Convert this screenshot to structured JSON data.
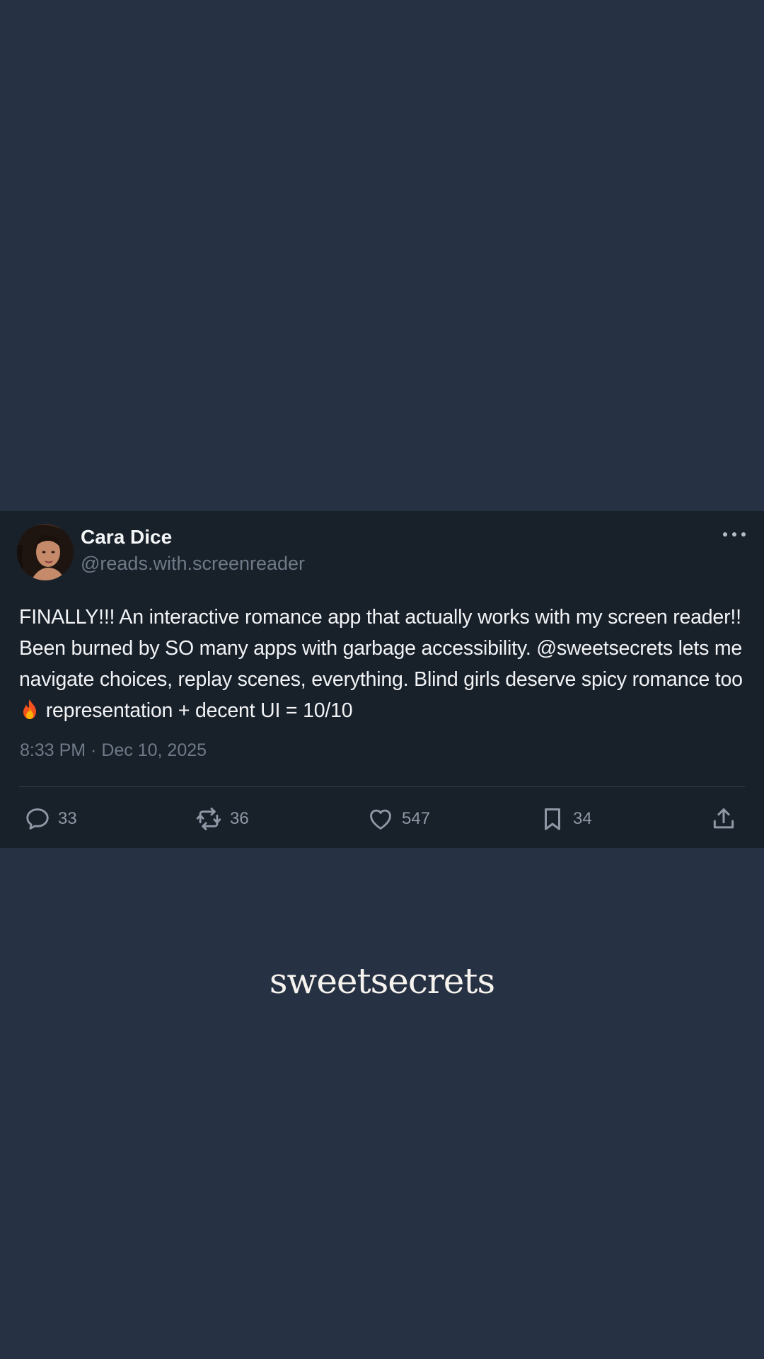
{
  "tweet": {
    "author_name": "Cara Dice",
    "author_handle": "@reads.with.screenreader",
    "text_before_emoji": "FINALLY!!! An interactive romance app that actually works with my screen reader!! Been burned by SO many apps with garbage accessibility. @sweetsecrets lets me navigate choices, replay scenes, everything. Blind girls deserve spicy romance too",
    "emoji_icon": "fire-emoji",
    "text_after_emoji": "representation + decent UI = 10/10",
    "timestamp": "8:33 PM · Dec 10, 2025",
    "actions": {
      "replies": "33",
      "reposts": "36",
      "likes": "547",
      "bookmarks": "34"
    }
  },
  "brand": {
    "wordmark": "sweetsecrets"
  },
  "colors": {
    "page_background": "#263243",
    "card_background": "#18202a",
    "text_primary": "#f2f3f5",
    "text_secondary": "#6f7a88",
    "icon_color": "#8f99a6"
  }
}
